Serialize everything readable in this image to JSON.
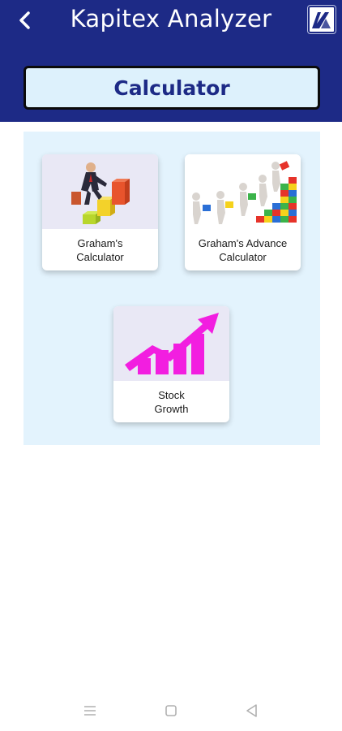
{
  "header": {
    "title": "Kapitex Analyzer",
    "back_icon": "chevron-left-icon",
    "logo_icon": "app-logo-icon",
    "background_color": "#1d2a86"
  },
  "section": {
    "title": "Calculator"
  },
  "cards": [
    {
      "line1": "Graham's",
      "line2": "Calculator",
      "icon": "businessman-stairs-icon"
    },
    {
      "line1": "Graham's Advance",
      "line2": "Calculator",
      "icon": "team-building-blocks-icon"
    },
    {
      "line1": "Stock",
      "line2": "Growth",
      "icon": "growth-chart-icon"
    }
  ],
  "navbar": {
    "icons": [
      "menu-icon",
      "home-square-icon",
      "back-triangle-icon"
    ]
  }
}
